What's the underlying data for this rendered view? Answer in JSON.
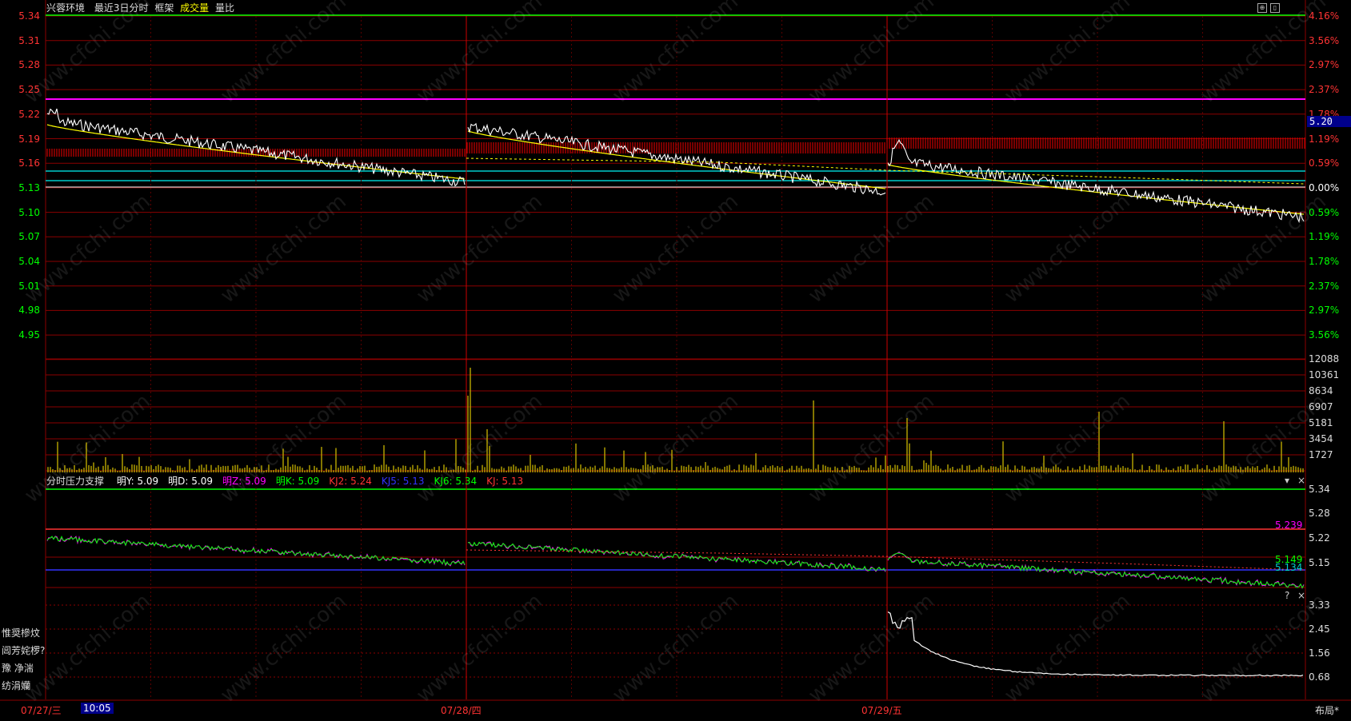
{
  "header": {
    "stock_name": "兴蓉环境",
    "period_label": "最近3日分时",
    "frame_label": "框架",
    "volume_label": "成交量",
    "ratio_label": "量比"
  },
  "colors": {
    "price_line": "#ffffff",
    "avg_line": "#ffff00",
    "up": "#ff3333",
    "down": "#00ff00",
    "magenta": "#ff00ff",
    "cyan": "#00cccc",
    "blue": "#3333ff",
    "grid": "#8b0000"
  },
  "price_axis": {
    "left_ticks": [
      "5.34",
      "5.31",
      "5.28",
      "5.25",
      "5.22",
      "5.19",
      "5.16",
      "5.13",
      "5.10",
      "5.07",
      "5.04",
      "5.01",
      "4.98",
      "4.95"
    ],
    "right_ticks": [
      "4.16%",
      "3.56%",
      "2.97%",
      "2.37%",
      "1.78%",
      "1.19%",
      "0.59%",
      "0.00%",
      "0.59%",
      "1.19%",
      "1.78%",
      "2.37%",
      "2.97%",
      "3.56%"
    ],
    "current_price": "5.20"
  },
  "volume_axis": {
    "right_ticks": [
      "12088",
      "10361",
      "8634",
      "6907",
      "5181",
      "3454",
      "1727"
    ]
  },
  "indicator": {
    "name": "分时压力支撑",
    "items": [
      {
        "label": "明Y: 5.09",
        "color": "#ffffff"
      },
      {
        "label": "明D: 5.09",
        "color": "#ffffff"
      },
      {
        "label": "明Z: 5.09",
        "color": "#ff00ff"
      },
      {
        "label": "明K: 5.09",
        "color": "#00ff00"
      },
      {
        "label": "KJ2: 5.24",
        "color": "#ff3333"
      },
      {
        "label": "KJ5: 5.13",
        "color": "#3333ff"
      },
      {
        "label": "KJ6: 5.34",
        "color": "#00ff00"
      },
      {
        "label": "KJ: 5.13",
        "color": "#ff3333"
      }
    ],
    "right_ticks": [
      "5.34",
      "5.28",
      "5.22",
      "5.15"
    ],
    "level_labels": [
      {
        "text": "5.239",
        "color": "#ff00ff"
      },
      {
        "text": "5.149",
        "color": "#00ff00"
      },
      {
        "text": "5.134",
        "color": "#00cccc"
      }
    ],
    "dropdown": "▾",
    "close": "×"
  },
  "bottom_panel": {
    "right_ticks": [
      "3.33",
      "2.45",
      "1.56",
      "0.68"
    ],
    "help": "?",
    "close": "×",
    "side_labels": [
      "惟奨槮炆",
      "阊芳姹椤?(",
      "豫 净湍",
      "纺涓孏"
    ]
  },
  "time_axis": {
    "labels": [
      "07/27/三",
      "07/28/四",
      "07/29/五"
    ],
    "cursor_time": "10:05",
    "layout_button": "布局*"
  },
  "watermark": "www.cfchi.com"
}
